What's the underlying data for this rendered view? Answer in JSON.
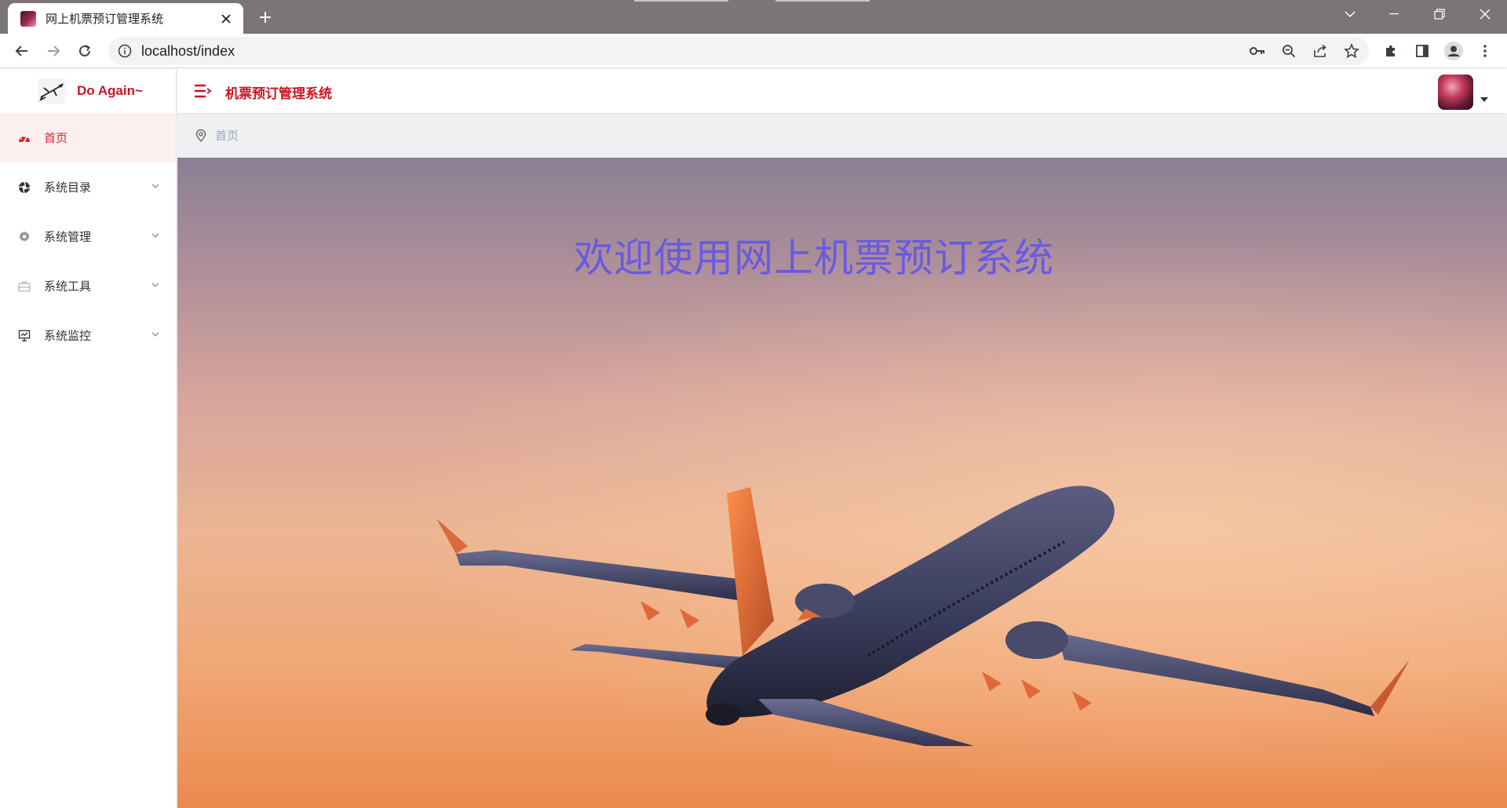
{
  "browser": {
    "tab_title": "网上机票预订管理系统",
    "url": "localhost/index"
  },
  "sidebar": {
    "brand": "Do Again~",
    "items": [
      {
        "label": "首页",
        "icon": "dashboard-icon",
        "active": true
      },
      {
        "label": "系统目录",
        "icon": "aperture-icon",
        "expandable": true
      },
      {
        "label": "系统管理",
        "icon": "gear-icon",
        "expandable": true
      },
      {
        "label": "系统工具",
        "icon": "toolbox-icon",
        "expandable": true
      },
      {
        "label": "系统监控",
        "icon": "monitor-icon",
        "expandable": true
      }
    ]
  },
  "navbar": {
    "title": "机票预订管理系统"
  },
  "breadcrumb": {
    "current": "首页"
  },
  "hero": {
    "welcome_text": "欢迎使用网上机票预订系统"
  },
  "colors": {
    "accent": "#cf1322",
    "active_bg": "#fbeff0",
    "welcome": "#6a5ae0",
    "tabstrip": "#7a7576"
  }
}
